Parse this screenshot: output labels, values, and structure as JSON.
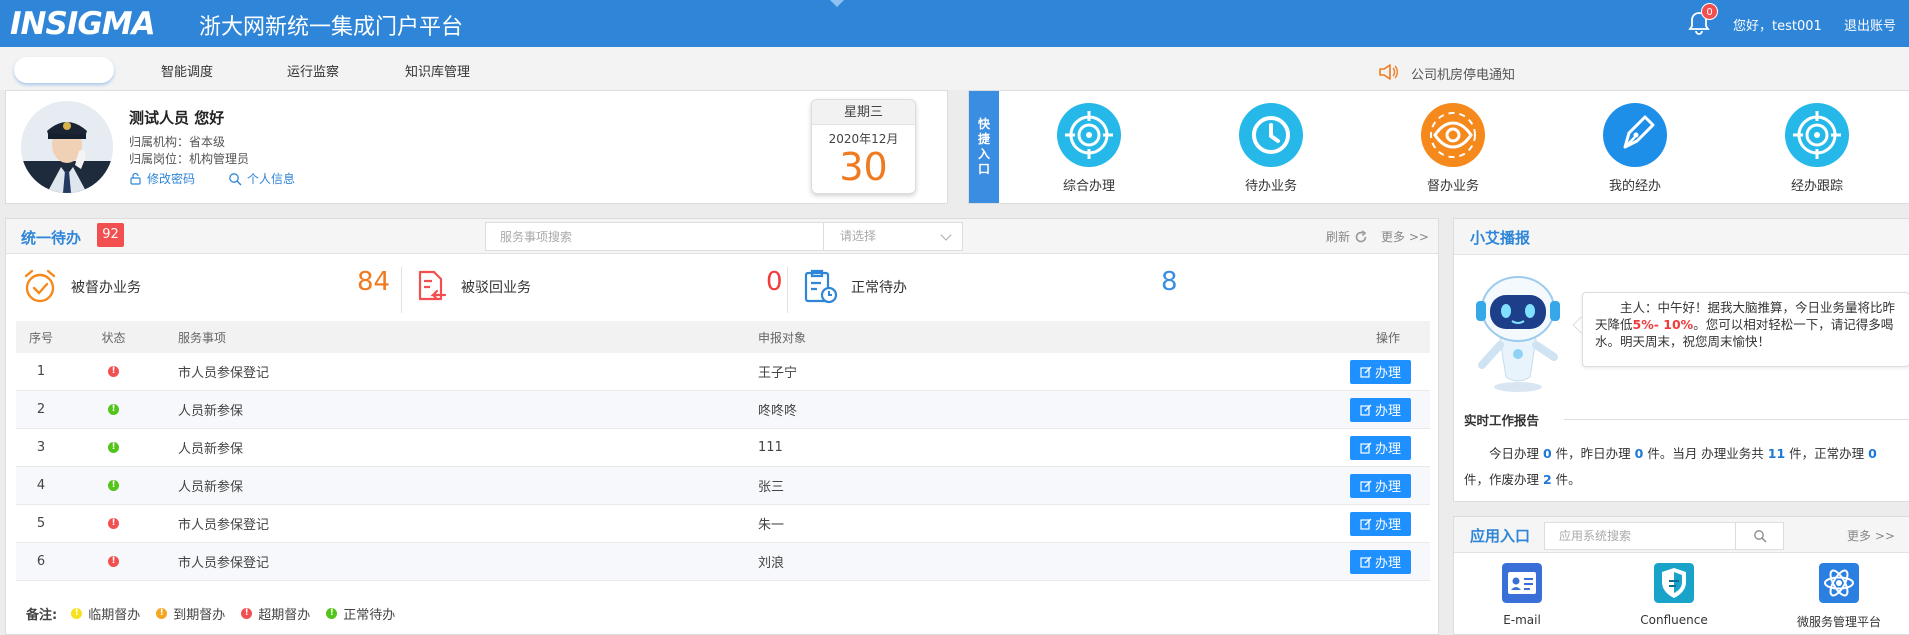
{
  "header": {
    "logo_text": "INSIGMA",
    "platform_title": "浙大网新统一集成门户平台",
    "notification_count": "0",
    "greeting": "您好，test001",
    "logout_label": "退出账号",
    "brand_color": "#2f86d8"
  },
  "nav": {
    "items": [
      "智能调度",
      "运行监察",
      "知识库管理"
    ],
    "notice": "公司机房停电通知"
  },
  "user": {
    "hello": "测试人员 您好",
    "org": "归属机构：省本级",
    "position": "归属岗位：机构管理员",
    "change_password": "修改密码",
    "personal_info": "个人信息"
  },
  "date": {
    "weekday": "星期三",
    "year_month": "2020年12月",
    "day": "30"
  },
  "quick": {
    "label": "快捷入口",
    "items": [
      {
        "label": "综合办理",
        "icon": "target-icon",
        "color": "#25b8e8"
      },
      {
        "label": "待办业务",
        "icon": "clock-icon",
        "color": "#25b8e8"
      },
      {
        "label": "督办业务",
        "icon": "eye-icon",
        "color": "#f5891c"
      },
      {
        "label": "我的经办",
        "icon": "pen-icon",
        "color": "#1e8fe8"
      },
      {
        "label": "经办跟踪",
        "icon": "target-icon",
        "color": "#25b8e8"
      }
    ]
  },
  "todo": {
    "title": "统一待办",
    "count": "92",
    "search_placeholder": "服务事项搜索",
    "select_placeholder": "请选择",
    "refresh": "刷新",
    "more": "更多 >>",
    "stats": [
      {
        "label": "被督办业务",
        "value": "84",
        "color": "#f07a1f"
      },
      {
        "label": "被驳回业务",
        "value": "0",
        "color": "#f03c3c"
      },
      {
        "label": "正常待办",
        "value": "8",
        "color": "#3a8de0"
      }
    ],
    "columns": [
      "序号",
      "状态",
      "服务事项",
      "申报对象",
      "操作"
    ],
    "rows": [
      {
        "no": "1",
        "status": "red",
        "service": "市人员参保登记",
        "target": "王子宁",
        "action": "办理"
      },
      {
        "no": "2",
        "status": "green",
        "service": "人员新参保",
        "target": "咚咚咚",
        "action": "办理"
      },
      {
        "no": "3",
        "status": "green",
        "service": "人员新参保",
        "target": "111",
        "action": "办理"
      },
      {
        "no": "4",
        "status": "green",
        "service": "人员新参保",
        "target": "张三",
        "action": "办理"
      },
      {
        "no": "5",
        "status": "red",
        "service": "市人员参保登记",
        "target": "朱一",
        "action": "办理"
      },
      {
        "no": "6",
        "status": "red",
        "service": "市人员参保登记",
        "target": "刘浪",
        "action": "办理"
      }
    ],
    "legend_label": "备注:",
    "legend": [
      {
        "label": "临期督办",
        "color": "#f5e11c"
      },
      {
        "label": "到期督办",
        "color": "#f5a623"
      },
      {
        "label": "超期督办",
        "color": "#f25050"
      },
      {
        "label": "正常待办",
        "color": "#52c41a"
      }
    ]
  },
  "ai": {
    "title": "小艾播报",
    "bubble_pre": "主人：中午好！据我大脑推算，今日业务量将比昨天降低",
    "bubble_warn": "5%- 10%",
    "bubble_post": "。您可以相对轻松一下，请记得多喝水。明天周末，祝您周末愉快！",
    "report_title": "实时工作报告",
    "report": {
      "t1": "今日办理 ",
      "v1": "0",
      "t2": " 件，昨日办理 ",
      "v2": "0",
      "t3": " 件。当月 办理业务共 ",
      "v3": "11",
      "t4": " 件，正常办理 ",
      "v4": "0",
      "t5": " 件，作废办理 ",
      "v5": "2",
      "t6": " 件。"
    }
  },
  "apps": {
    "title": "应用入口",
    "search_placeholder": "应用系统搜索",
    "more": "更多 >>",
    "items": [
      {
        "label": "E-mail",
        "icon": "id-card-icon"
      },
      {
        "label": "Confluence",
        "icon": "shield-icon"
      },
      {
        "label": "微服务管理平台",
        "icon": "atom-icon"
      }
    ]
  }
}
